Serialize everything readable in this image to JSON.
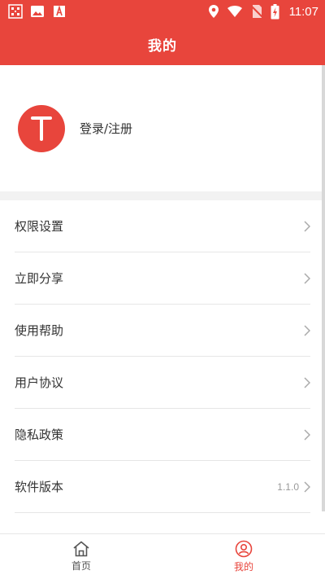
{
  "status_bar": {
    "time": "11:07",
    "icons_left": [
      "app-notification-icon",
      "image-icon",
      "text-a-icon"
    ],
    "icons_right": [
      "location-icon",
      "wifi-icon",
      "no-sim-icon",
      "battery-charging-icon"
    ]
  },
  "header": {
    "title": "我的"
  },
  "profile": {
    "avatar_letter": "T",
    "login_label": "登录/注册"
  },
  "menu": {
    "items": [
      {
        "label": "权限设置",
        "value": ""
      },
      {
        "label": "立即分享",
        "value": ""
      },
      {
        "label": "使用帮助",
        "value": ""
      },
      {
        "label": "用户协议",
        "value": ""
      },
      {
        "label": "隐私政策",
        "value": ""
      },
      {
        "label": "软件版本",
        "value": "1.1.0"
      }
    ]
  },
  "tabbar": {
    "tabs": [
      {
        "label": "首页",
        "icon": "home-icon",
        "active": false
      },
      {
        "label": "我的",
        "icon": "profile-icon",
        "active": true
      }
    ]
  },
  "colors": {
    "accent": "#e8453c",
    "divider": "#e6e6e6",
    "band": "#f2f2f2"
  }
}
